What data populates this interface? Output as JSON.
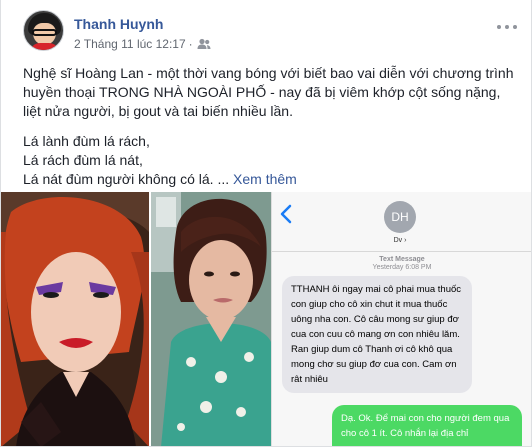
{
  "post": {
    "author": "Thanh Huynh",
    "timestamp": "2 Tháng 11 lúc 12:17",
    "separator": "·",
    "audience_icon": "friends-icon",
    "more_icon": "more-options-icon",
    "paragraph": "Nghệ sĩ Hoàng Lan - một thời vang bóng với biết bao vai diễn với chương trình huyền thoại TRONG NHÀ NGOÀI PHỐ - nay đã bị viêm khớp cột sống nặng, liệt nửa người, bị gout và tai biến nhiều lần.",
    "poem_lines": [
      "Lá lành đùm lá rách,",
      "Lá rách đùm lá nát,",
      "Lá nát đùm người không có lá."
    ],
    "ellipsis": " ... ",
    "see_more": "Xem thêm"
  },
  "sms": {
    "contact_initials": "DH",
    "contact_name": "Dv ›",
    "timestamp_label": "Text Message",
    "timestamp_value": "Yesterday 6:08 PM",
    "incoming": "TTHANH ôi ngay mai cô phai mua thuốc con giup cho cô xin  chut it mua thuốc uông nha con. Cô câu mong sư giup đơ cua con cuu cô mang ơn con nhiêu lăm. Ran giup dum cô Thanh ơi cô khô qua mong chơ su giup đơ cua con. Cam ơn rât nhiêu",
    "outgoing": "Dạ. Ok. Để mai con cho người đem qua cho cô 1 ít. Cô nhắn lại địa chỉ"
  },
  "colors": {
    "link": "#365899",
    "text": "#1d2129",
    "meta": "#616770",
    "bubble_in": "#e5e5ea",
    "bubble_out": "#4cd964"
  }
}
